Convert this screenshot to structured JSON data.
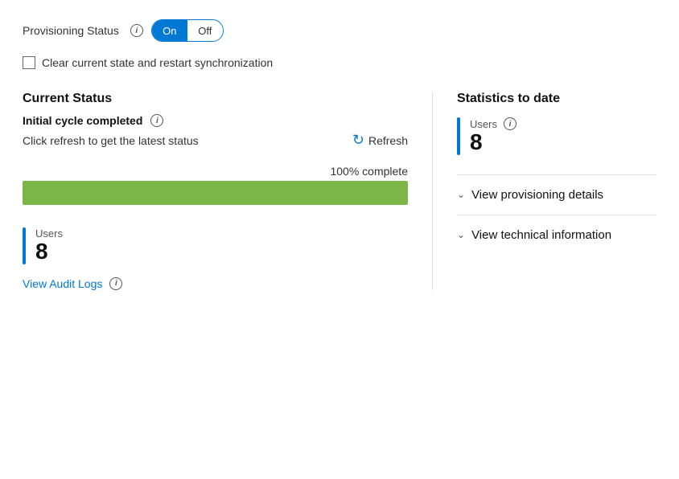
{
  "provisioning": {
    "label": "Provisioning Status",
    "info_icon": "i",
    "toggle_on": "On",
    "toggle_off": "Off"
  },
  "checkbox": {
    "label": "Clear current state and restart synchronization"
  },
  "left": {
    "current_status_title": "Current Status",
    "cycle_label": "Initial cycle completed",
    "refresh_hint": "Click refresh to get the latest status",
    "refresh_label": "Refresh",
    "progress_label": "100% complete",
    "progress_percent": 100
  },
  "bottom": {
    "users_label": "Users",
    "users_count": "8",
    "audit_link": "View Audit Logs"
  },
  "right": {
    "stats_title": "Statistics to date",
    "users_label": "Users",
    "users_count": "8",
    "view_provisioning_details": "View provisioning details",
    "view_technical_information": "View technical information"
  },
  "colors": {
    "accent": "#0078d4",
    "progress_green": "#7ab648"
  }
}
